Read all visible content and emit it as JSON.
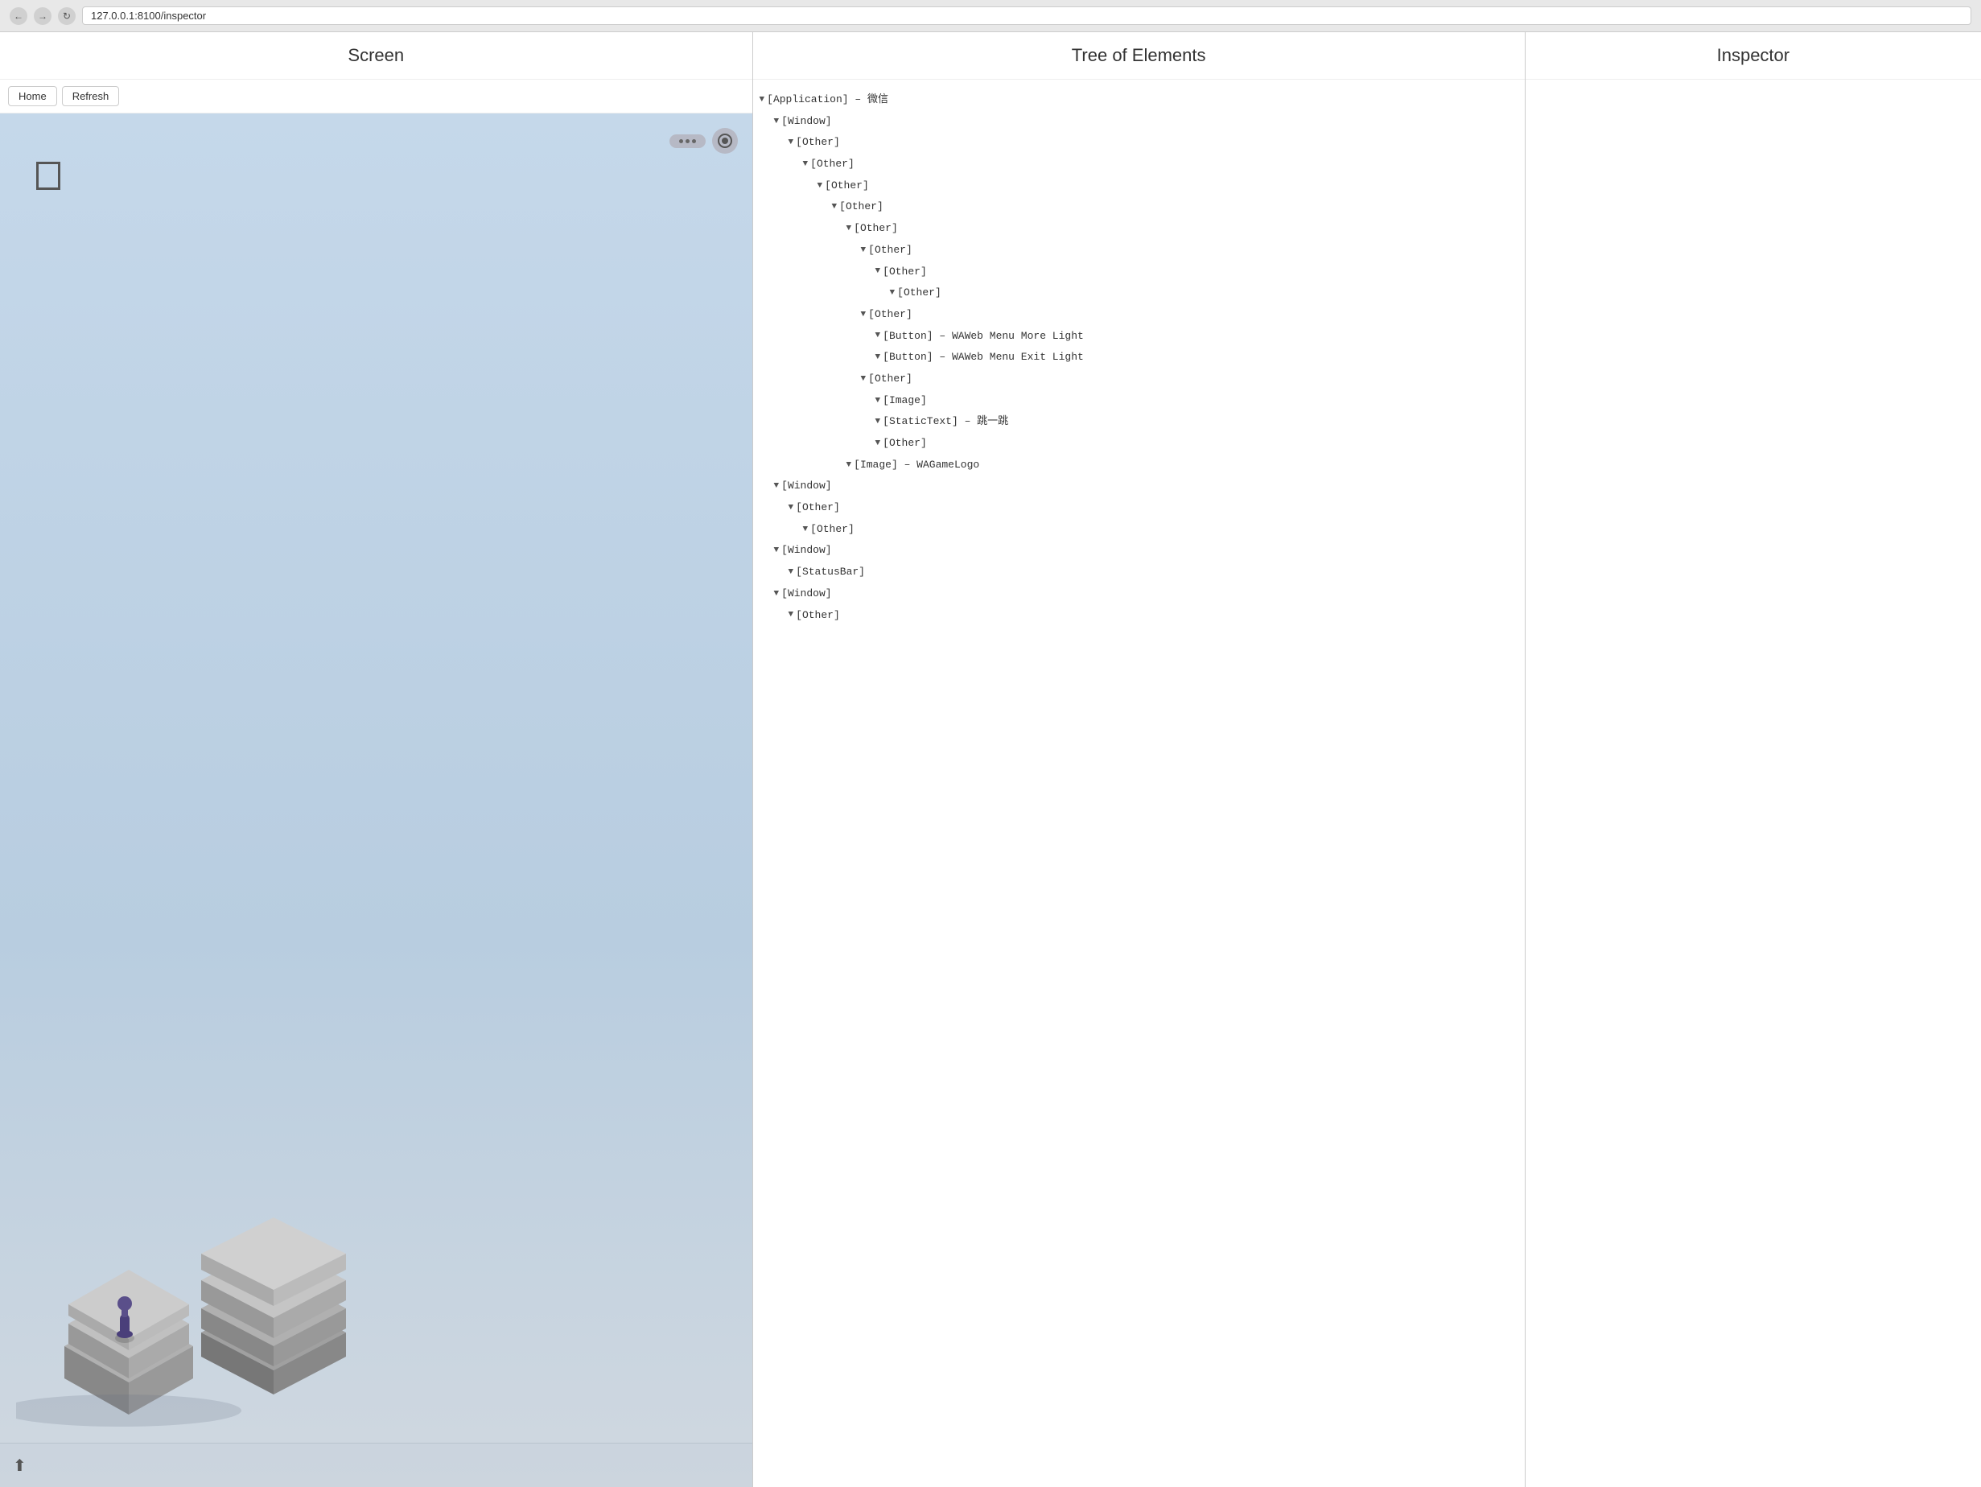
{
  "browser": {
    "url": "127.0.0.1:8100/inspector",
    "back_title": "Back",
    "forward_title": "Forward",
    "refresh_title": "Refresh"
  },
  "screen_panel": {
    "header": "Screen",
    "toolbar": {
      "home_label": "Home",
      "refresh_label": "Refresh"
    }
  },
  "tree_panel": {
    "header": "Tree of Elements",
    "nodes": [
      {
        "indent": 0,
        "arrow": "down",
        "text": "[Application] – 微信"
      },
      {
        "indent": 1,
        "arrow": "down",
        "text": "[Window]"
      },
      {
        "indent": 2,
        "arrow": "down",
        "text": "[Other]"
      },
      {
        "indent": 3,
        "arrow": "down",
        "text": "[Other]"
      },
      {
        "indent": 4,
        "arrow": "down",
        "text": "[Other]"
      },
      {
        "indent": 5,
        "arrow": "down",
        "text": "[Other]"
      },
      {
        "indent": 6,
        "arrow": "down",
        "text": "[Other]"
      },
      {
        "indent": 7,
        "arrow": "down",
        "text": "[Other]"
      },
      {
        "indent": 8,
        "arrow": "down",
        "text": "[Other]"
      },
      {
        "indent": 9,
        "arrow": "down",
        "text": "[Other]"
      },
      {
        "indent": 7,
        "arrow": "down",
        "text": "[Other]"
      },
      {
        "indent": 8,
        "arrow": "down",
        "text": "[Button] – WAWeb Menu More Light"
      },
      {
        "indent": 8,
        "arrow": "down",
        "text": "[Button] – WAWeb Menu Exit Light"
      },
      {
        "indent": 7,
        "arrow": "down",
        "text": "[Other]"
      },
      {
        "indent": 8,
        "arrow": "down",
        "text": "[Image]"
      },
      {
        "indent": 8,
        "arrow": "down",
        "text": "[StaticText] – 跳一跳"
      },
      {
        "indent": 8,
        "arrow": "down",
        "text": "[Other]"
      },
      {
        "indent": 6,
        "arrow": "down",
        "text": "[Image] – WAGameLogo"
      },
      {
        "indent": 1,
        "arrow": "down",
        "text": "[Window]"
      },
      {
        "indent": 2,
        "arrow": "down",
        "text": "[Other]"
      },
      {
        "indent": 3,
        "arrow": "down",
        "text": "[Other]"
      },
      {
        "indent": 1,
        "arrow": "down",
        "text": "[Window]"
      },
      {
        "indent": 2,
        "arrow": "down",
        "text": "[StatusBar]"
      },
      {
        "indent": 1,
        "arrow": "down",
        "text": "[Window]"
      },
      {
        "indent": 2,
        "arrow": "down",
        "text": "[Other]"
      }
    ]
  },
  "inspector_panel": {
    "header": "Inspector"
  }
}
